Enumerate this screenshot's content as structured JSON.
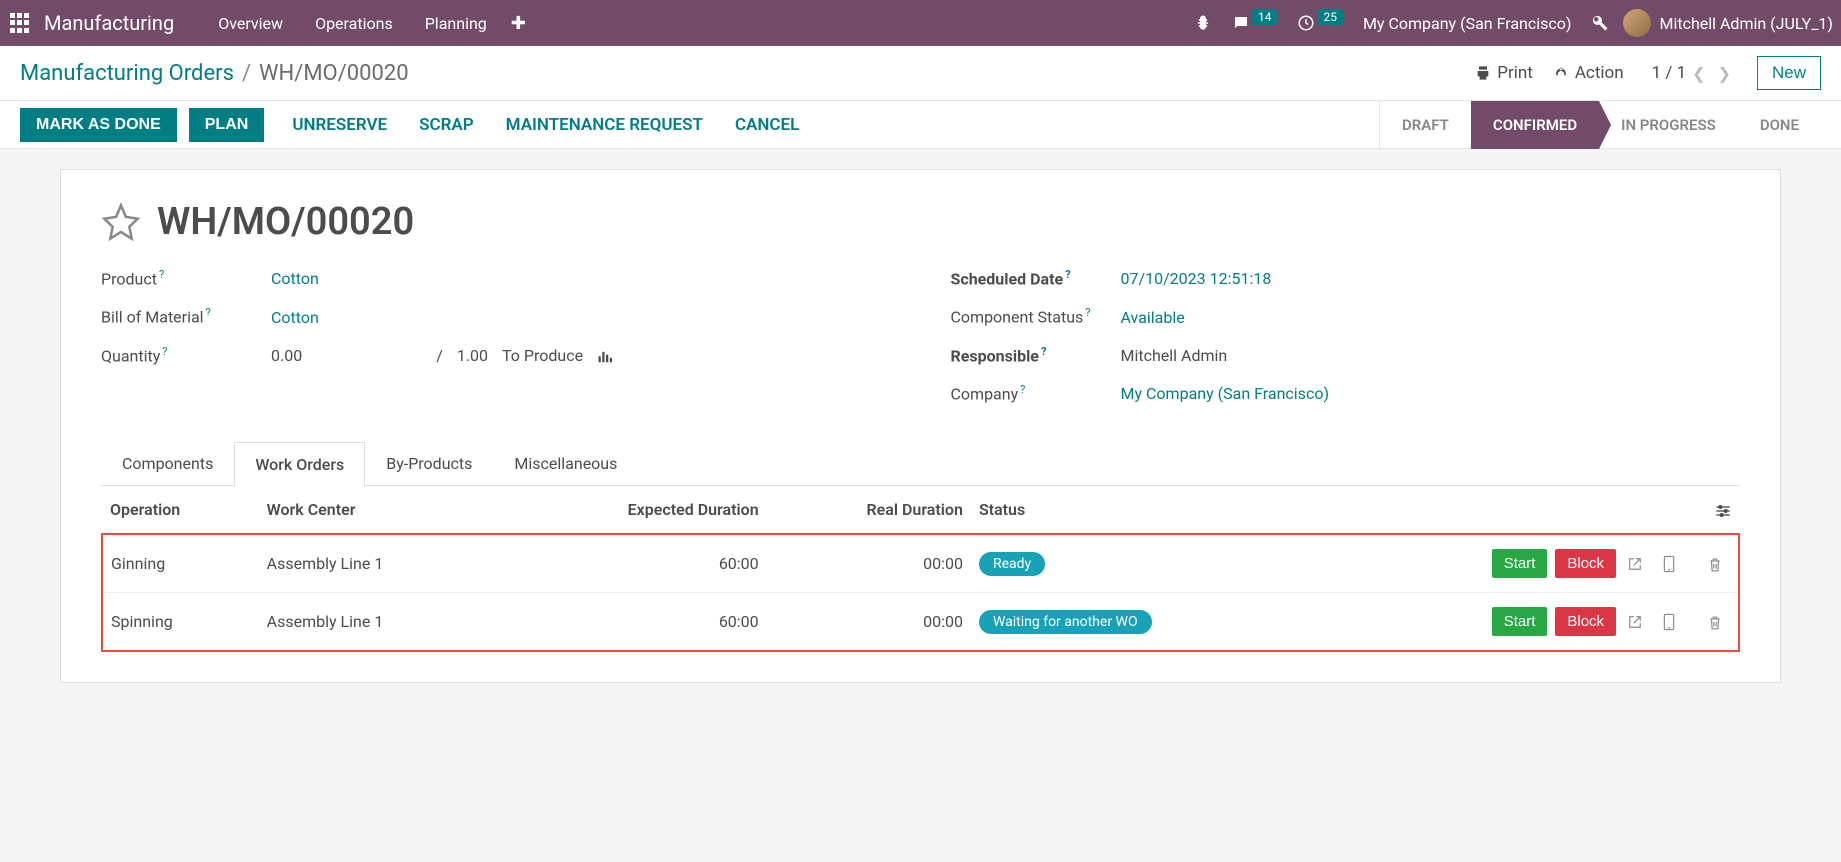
{
  "topbar": {
    "app_title": "Manufacturing",
    "nav": [
      "Overview",
      "Operations",
      "Planning"
    ],
    "msg_count": "14",
    "activity_count": "25",
    "company": "My Company (San Francisco)",
    "user": "Mitchell Admin (JULY_1)"
  },
  "breadcrumb": {
    "root": "Manufacturing Orders",
    "current": "WH/MO/00020",
    "print": "Print",
    "action": "Action",
    "pager": "1 / 1",
    "new_btn": "New"
  },
  "commands": {
    "mark_done": "MARK AS DONE",
    "plan": "PLAN",
    "unreserve": "UNRESERVE",
    "scrap": "SCRAP",
    "maintenance": "MAINTENANCE REQUEST",
    "cancel": "CANCEL"
  },
  "status_steps": [
    "DRAFT",
    "CONFIRMED",
    "IN PROGRESS",
    "DONE"
  ],
  "form": {
    "title": "WH/MO/00020",
    "product_label": "Product",
    "product": "Cotton",
    "bom_label": "Bill of Material",
    "bom": "Cotton",
    "qty_label": "Quantity",
    "qty": "0.00",
    "qty_planned": "1.00",
    "qty_uom": "To Produce",
    "sched_label": "Scheduled Date",
    "sched": "07/10/2023 12:51:18",
    "comp_status_label": "Component Status",
    "comp_status": "Available",
    "resp_label": "Responsible",
    "resp": "Mitchell Admin",
    "company_label": "Company",
    "company": "My Company (San Francisco)"
  },
  "tabs": [
    "Components",
    "Work Orders",
    "By-Products",
    "Miscellaneous"
  ],
  "wo_headers": {
    "operation": "Operation",
    "work_center": "Work Center",
    "expected": "Expected Duration",
    "real": "Real Duration",
    "status": "Status"
  },
  "work_orders": [
    {
      "operation": "Ginning",
      "work_center": "Assembly Line 1",
      "expected": "60:00",
      "real": "00:00",
      "status": "Ready",
      "pill_class": "pill-teal"
    },
    {
      "operation": "Spinning",
      "work_center": "Assembly Line 1",
      "expected": "60:00",
      "real": "00:00",
      "status": "Waiting for another WO",
      "pill_class": "pill-teal"
    }
  ],
  "btn": {
    "start": "Start",
    "block": "Block"
  },
  "help": "?",
  "slash": "/"
}
